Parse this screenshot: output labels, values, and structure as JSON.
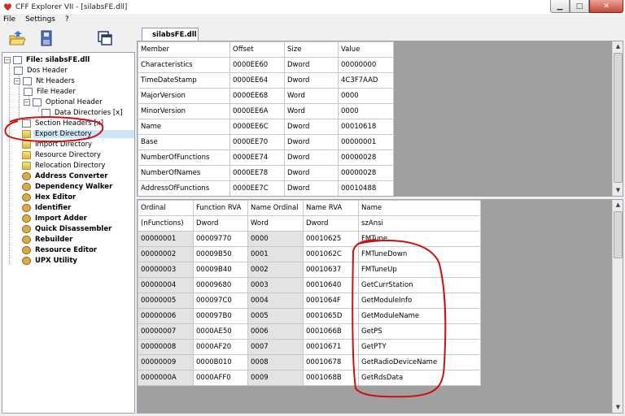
{
  "window": {
    "title": "CFF Explorer VII - [silabsFE.dll]"
  },
  "menu": {
    "items": [
      "File",
      "Settings",
      "?"
    ]
  },
  "tab": {
    "label": "silabsFE.dll"
  },
  "tree": {
    "root": "File: silabsFE.dll",
    "dos_header": "Dos Header",
    "nt_headers": "Nt Headers",
    "file_header": "File Header",
    "optional_header": "Optional Header",
    "data_directories": "Data Directories [x]",
    "section_headers": "Section Headers [x]",
    "export_directory": "Export Directory",
    "import_directory": "Import Directory",
    "resource_directory": "Resource Directory",
    "relocation_directory": "Relocation Directory",
    "address_converter": "Address Converter",
    "dependency_walker": "Dependency Walker",
    "hex_editor": "Hex Editor",
    "identifier": "Identifier",
    "import_adder": "Import Adder",
    "quick_disassembler": "Quick Disassembler",
    "rebuilder": "Rebuilder",
    "resource_editor": "Resource Editor",
    "upx_utility": "UPX Utility"
  },
  "upper_table": {
    "headers": [
      "Member",
      "Offset",
      "Size",
      "Value"
    ],
    "rows": [
      [
        "Characteristics",
        "0000EE60",
        "Dword",
        "00000000"
      ],
      [
        "TimeDateStamp",
        "0000EE64",
        "Dword",
        "4C3F7AAD"
      ],
      [
        "MajorVersion",
        "0000EE68",
        "Word",
        "0000"
      ],
      [
        "MinorVersion",
        "0000EE6A",
        "Word",
        "0000"
      ],
      [
        "Name",
        "0000EE6C",
        "Dword",
        "00010618"
      ],
      [
        "Base",
        "0000EE70",
        "Dword",
        "00000001"
      ],
      [
        "NumberOfFunctions",
        "0000EE74",
        "Dword",
        "00000028"
      ],
      [
        "NumberOfNames",
        "0000EE78",
        "Dword",
        "00000028"
      ],
      [
        "AddressOfFunctions",
        "0000EE7C",
        "Dword",
        "00010488"
      ]
    ]
  },
  "lower_table": {
    "headers": [
      "Ordinal",
      "Function RVA",
      "Name Ordinal",
      "Name RVA",
      "Name"
    ],
    "types": [
      "(nFunctions)",
      "Dword",
      "Word",
      "Dword",
      "szAnsi"
    ],
    "rows": [
      [
        "00000001",
        "00009770",
        "0000",
        "00010625",
        "FMTune"
      ],
      [
        "00000002",
        "00009B50",
        "0001",
        "0001062C",
        "FMTuneDown"
      ],
      [
        "00000003",
        "00009B40",
        "0002",
        "00010637",
        "FMTuneUp"
      ],
      [
        "00000004",
        "00009680",
        "0003",
        "00010640",
        "GetCurrStation"
      ],
      [
        "00000005",
        "000097C0",
        "0004",
        "0001064F",
        "GetModuleInfo"
      ],
      [
        "00000006",
        "000097B0",
        "0005",
        "0001065D",
        "GetModuleName"
      ],
      [
        "00000007",
        "0000AE50",
        "0006",
        "0001066B",
        "GetPS"
      ],
      [
        "00000008",
        "0000AF20",
        "0007",
        "00010671",
        "GetPTY"
      ],
      [
        "00000009",
        "0000B010",
        "0008",
        "00010678",
        "GetRadioDeviceName"
      ],
      [
        "0000000A",
        "0000AFF0",
        "0009",
        "0001068B",
        "GetRdsData"
      ]
    ]
  },
  "colors": {
    "selection": "#cde3f6",
    "annotation": "#cc1111",
    "pane_bg": "#a0a0a0"
  }
}
